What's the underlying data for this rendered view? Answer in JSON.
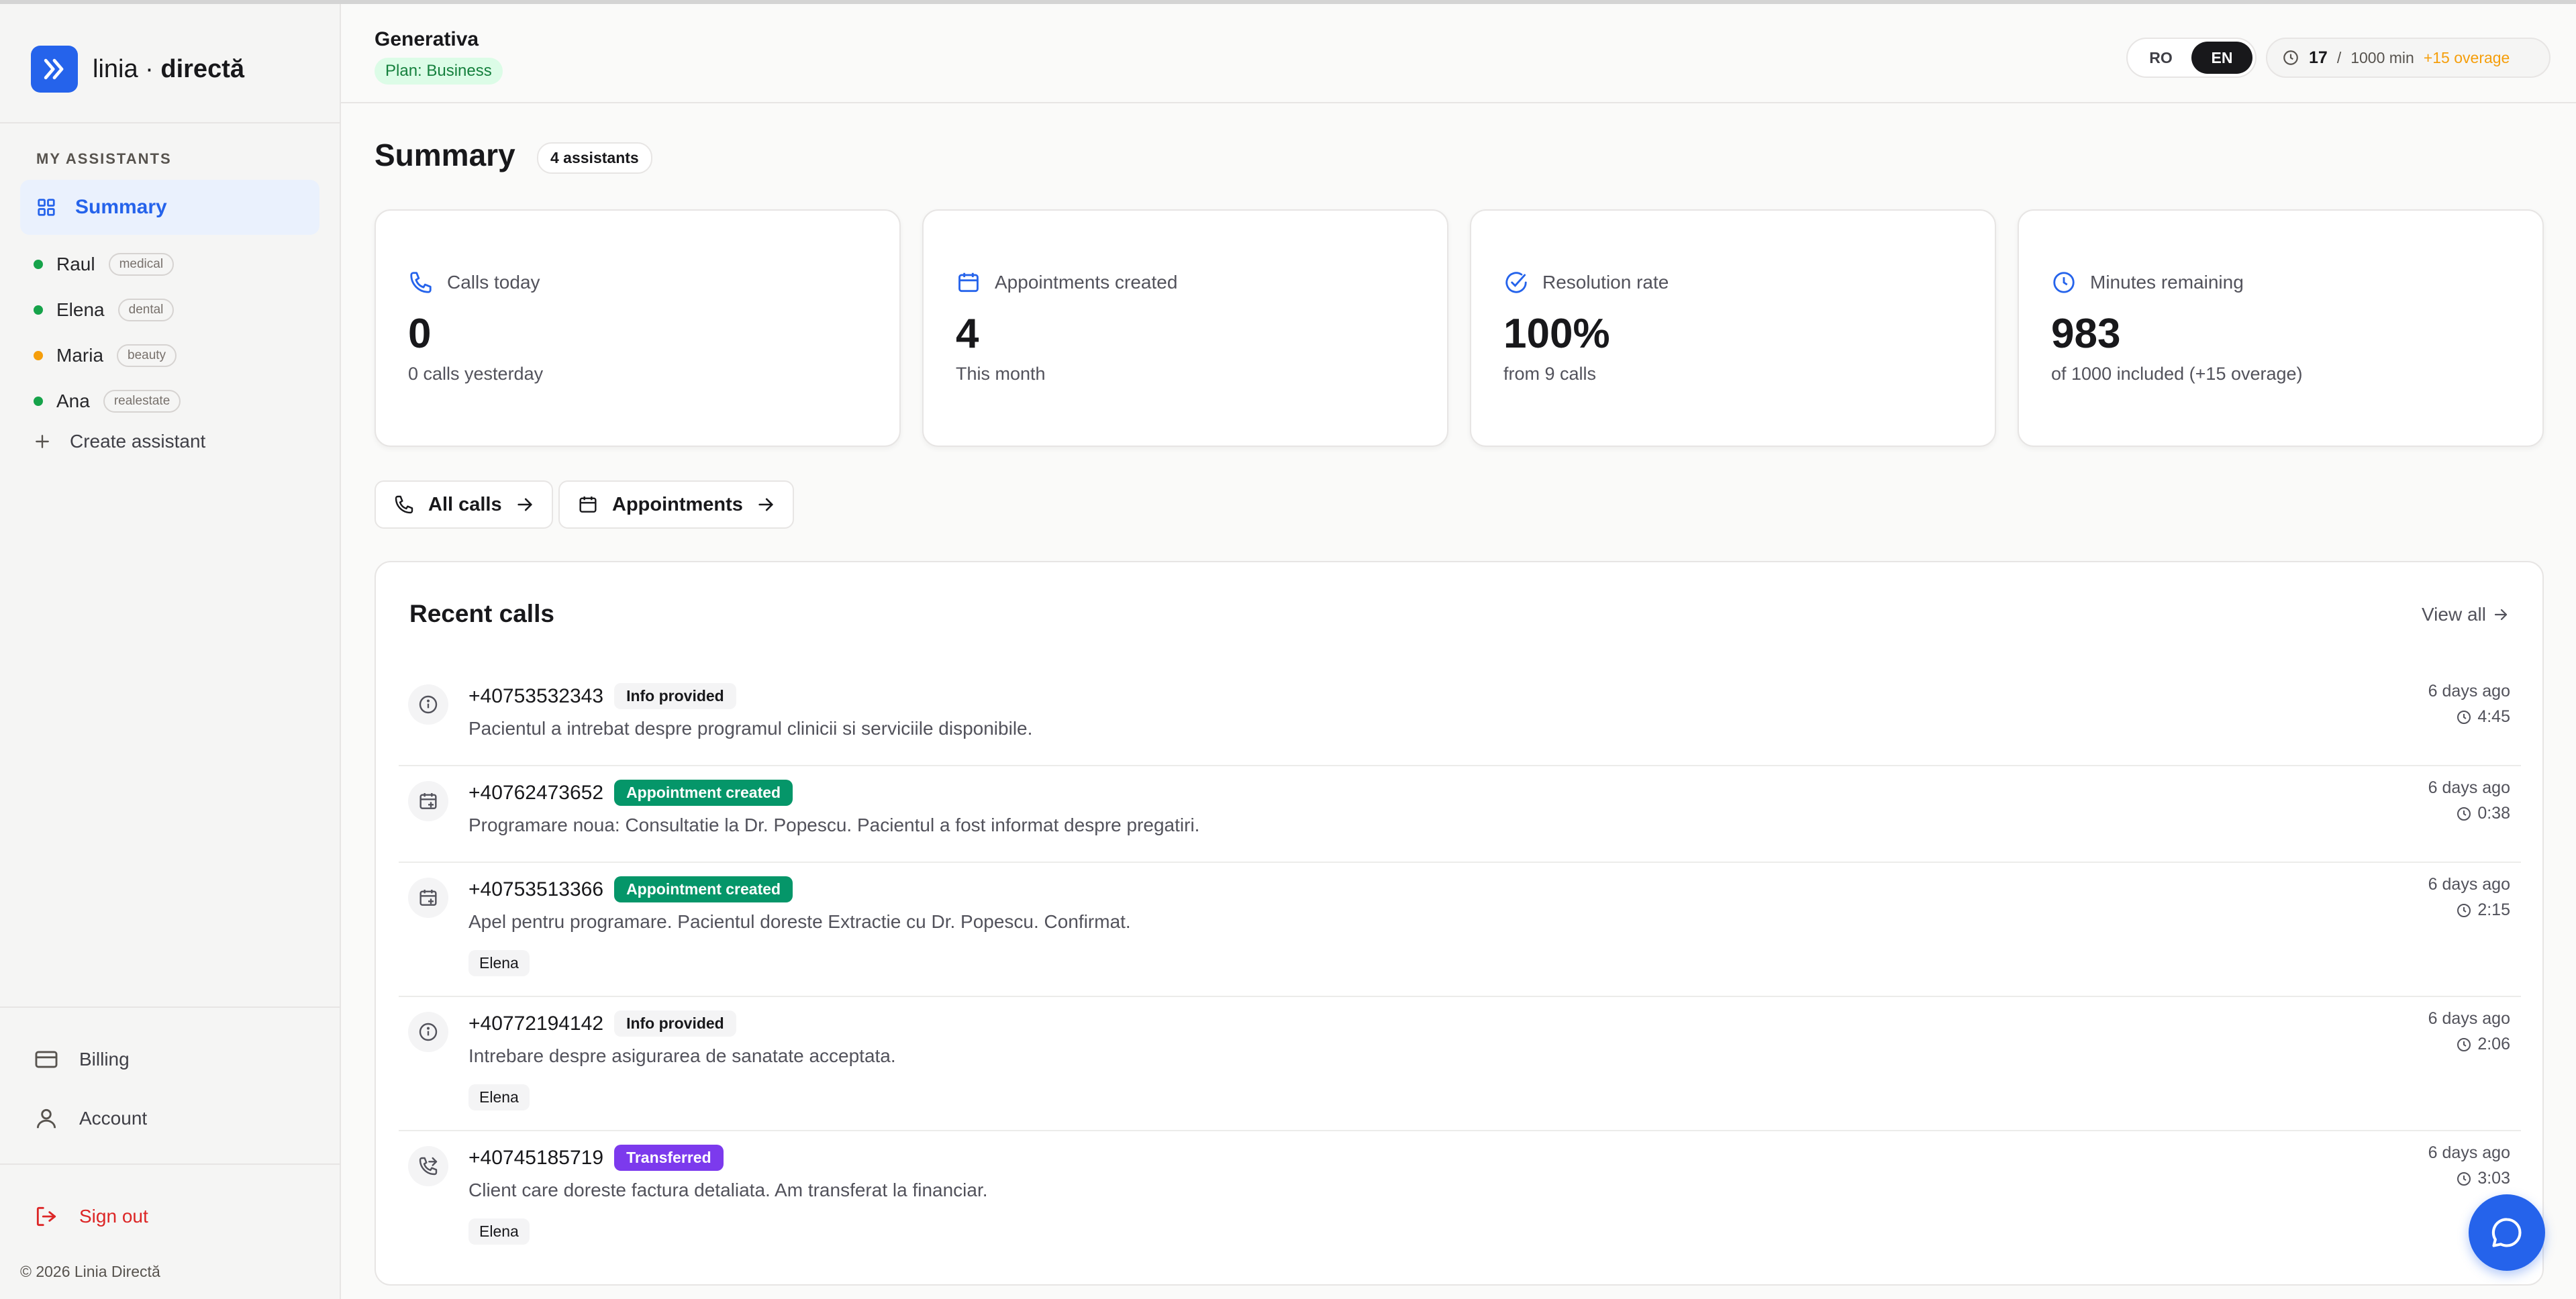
{
  "brand": {
    "name_light": "linia · ",
    "name_bold": "directă"
  },
  "sidebar": {
    "section_label": "MY ASSISTANTS",
    "summary_label": "Summary",
    "assistants": [
      {
        "name": "Raul",
        "tag": "medical",
        "status_color": "#16a34a"
      },
      {
        "name": "Elena",
        "tag": "dental",
        "status_color": "#16a34a"
      },
      {
        "name": "Maria",
        "tag": "beauty",
        "status_color": "#f59e0b"
      },
      {
        "name": "Ana",
        "tag": "realestate",
        "status_color": "#16a34a"
      }
    ],
    "create_label": "Create assistant",
    "billing_label": "Billing",
    "account_label": "Account",
    "signout_label": "Sign out",
    "copyright": "© 2026 Linia Directă"
  },
  "header": {
    "org_name": "Generativa",
    "plan": "Plan: Business",
    "languages": [
      "RO",
      "EN"
    ],
    "active_language": "EN",
    "usage_used": "17",
    "usage_sep": "/",
    "usage_total": "1000 min",
    "usage_overage": "+15 overage"
  },
  "main": {
    "title": "Summary",
    "assistant_count": "4 assistants",
    "stats": [
      {
        "label": "Calls today",
        "value": "0",
        "sub": "0 calls yesterday",
        "icon": "phone-icon"
      },
      {
        "label": "Appointments created",
        "value": "4",
        "sub": "This month",
        "icon": "calendar-icon"
      },
      {
        "label": "Resolution rate",
        "value": "100%",
        "sub": "from 9 calls",
        "icon": "check-circle-icon"
      },
      {
        "label": "Minutes remaining",
        "value": "983",
        "sub": "of 1000 included (+15 overage)",
        "icon": "clock-icon"
      }
    ],
    "actions": {
      "all_calls": "All calls",
      "appointments": "Appointments"
    }
  },
  "recent": {
    "title": "Recent calls",
    "view_all": "View all",
    "calls": [
      {
        "phone": "+40753532343",
        "status": "Info provided",
        "desc": "Pacientul a intrebat despre programul clinicii si serviciile disponibile.",
        "agent": "",
        "when": "6 days ago",
        "duration": "4:45"
      },
      {
        "phone": "+40762473652",
        "status": "Appointment created",
        "desc": "Programare noua: Consultatie la Dr. Popescu. Pacientul a fost informat despre pregatiri.",
        "agent": "",
        "when": "6 days ago",
        "duration": "0:38"
      },
      {
        "phone": "+40753513366",
        "status": "Appointment created",
        "desc": "Apel pentru programare. Pacientul doreste Extractie cu Dr. Popescu. Confirmat.",
        "agent": "Elena",
        "when": "6 days ago",
        "duration": "2:15"
      },
      {
        "phone": "+40772194142",
        "status": "Info provided",
        "desc": "Intrebare despre asigurarea de sanatate acceptata.",
        "agent": "Elena",
        "when": "6 days ago",
        "duration": "2:06"
      },
      {
        "phone": "+40745185719",
        "status": "Transferred",
        "desc": "Client care doreste factura detaliata. Am transferat la financiar.",
        "agent": "Elena",
        "when": "6 days ago",
        "duration": "3:03"
      }
    ]
  },
  "colors": {
    "accent": "#2563eb",
    "success": "#059669",
    "transfer": "#7c3aed",
    "warning": "#f59e0b",
    "danger": "#dc2626"
  }
}
